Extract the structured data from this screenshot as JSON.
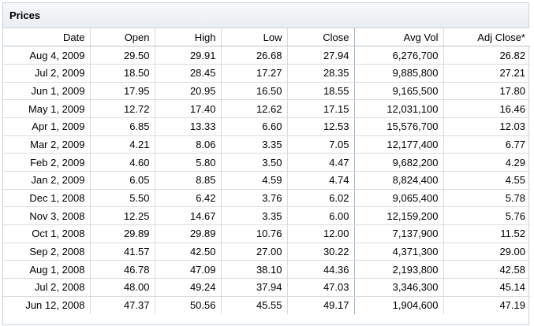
{
  "panel": {
    "title": "Prices"
  },
  "columns": [
    "Date",
    "Open",
    "High",
    "Low",
    "Close",
    "Avg Vol",
    "Adj Close*"
  ],
  "rows": [
    [
      "Aug 4, 2009",
      "29.50",
      "29.91",
      "26.68",
      "27.94",
      "6,276,700",
      "26.82"
    ],
    [
      "Jul 2, 2009",
      "18.50",
      "28.45",
      "17.27",
      "28.35",
      "9,885,800",
      "27.21"
    ],
    [
      "Jun 1, 2009",
      "17.95",
      "20.95",
      "16.50",
      "18.55",
      "9,165,500",
      "17.80"
    ],
    [
      "May 1, 2009",
      "12.72",
      "17.40",
      "12.62",
      "17.15",
      "12,031,100",
      "16.46"
    ],
    [
      "Apr 1, 2009",
      "6.85",
      "13.33",
      "6.60",
      "12.53",
      "15,576,700",
      "12.03"
    ],
    [
      "Mar 2, 2009",
      "4.21",
      "8.06",
      "3.35",
      "7.05",
      "12,177,400",
      "6.77"
    ],
    [
      "Feb 2, 2009",
      "4.60",
      "5.80",
      "3.50",
      "4.47",
      "9,682,200",
      "4.29"
    ],
    [
      "Jan 2, 2009",
      "6.05",
      "8.85",
      "4.59",
      "4.74",
      "8,824,400",
      "4.55"
    ],
    [
      "Dec 1, 2008",
      "5.50",
      "6.42",
      "3.76",
      "6.02",
      "9,065,400",
      "5.78"
    ],
    [
      "Nov 3, 2008",
      "12.25",
      "14.67",
      "3.35",
      "6.00",
      "12,159,200",
      "5.76"
    ],
    [
      "Oct 1, 2008",
      "29.89",
      "29.89",
      "10.76",
      "12.00",
      "7,137,900",
      "11.52"
    ],
    [
      "Sep 2, 2008",
      "41.57",
      "42.50",
      "27.00",
      "30.22",
      "4,371,300",
      "29.00"
    ],
    [
      "Aug 1, 2008",
      "46.78",
      "47.09",
      "38.10",
      "44.36",
      "2,193,800",
      "42.58"
    ],
    [
      "Jul 2, 2008",
      "48.00",
      "49.24",
      "37.94",
      "47.03",
      "3,346,300",
      "45.14"
    ],
    [
      "Jun 12, 2008",
      "47.37",
      "50.56",
      "45.55",
      "49.17",
      "1,904,600",
      "47.19"
    ]
  ]
}
